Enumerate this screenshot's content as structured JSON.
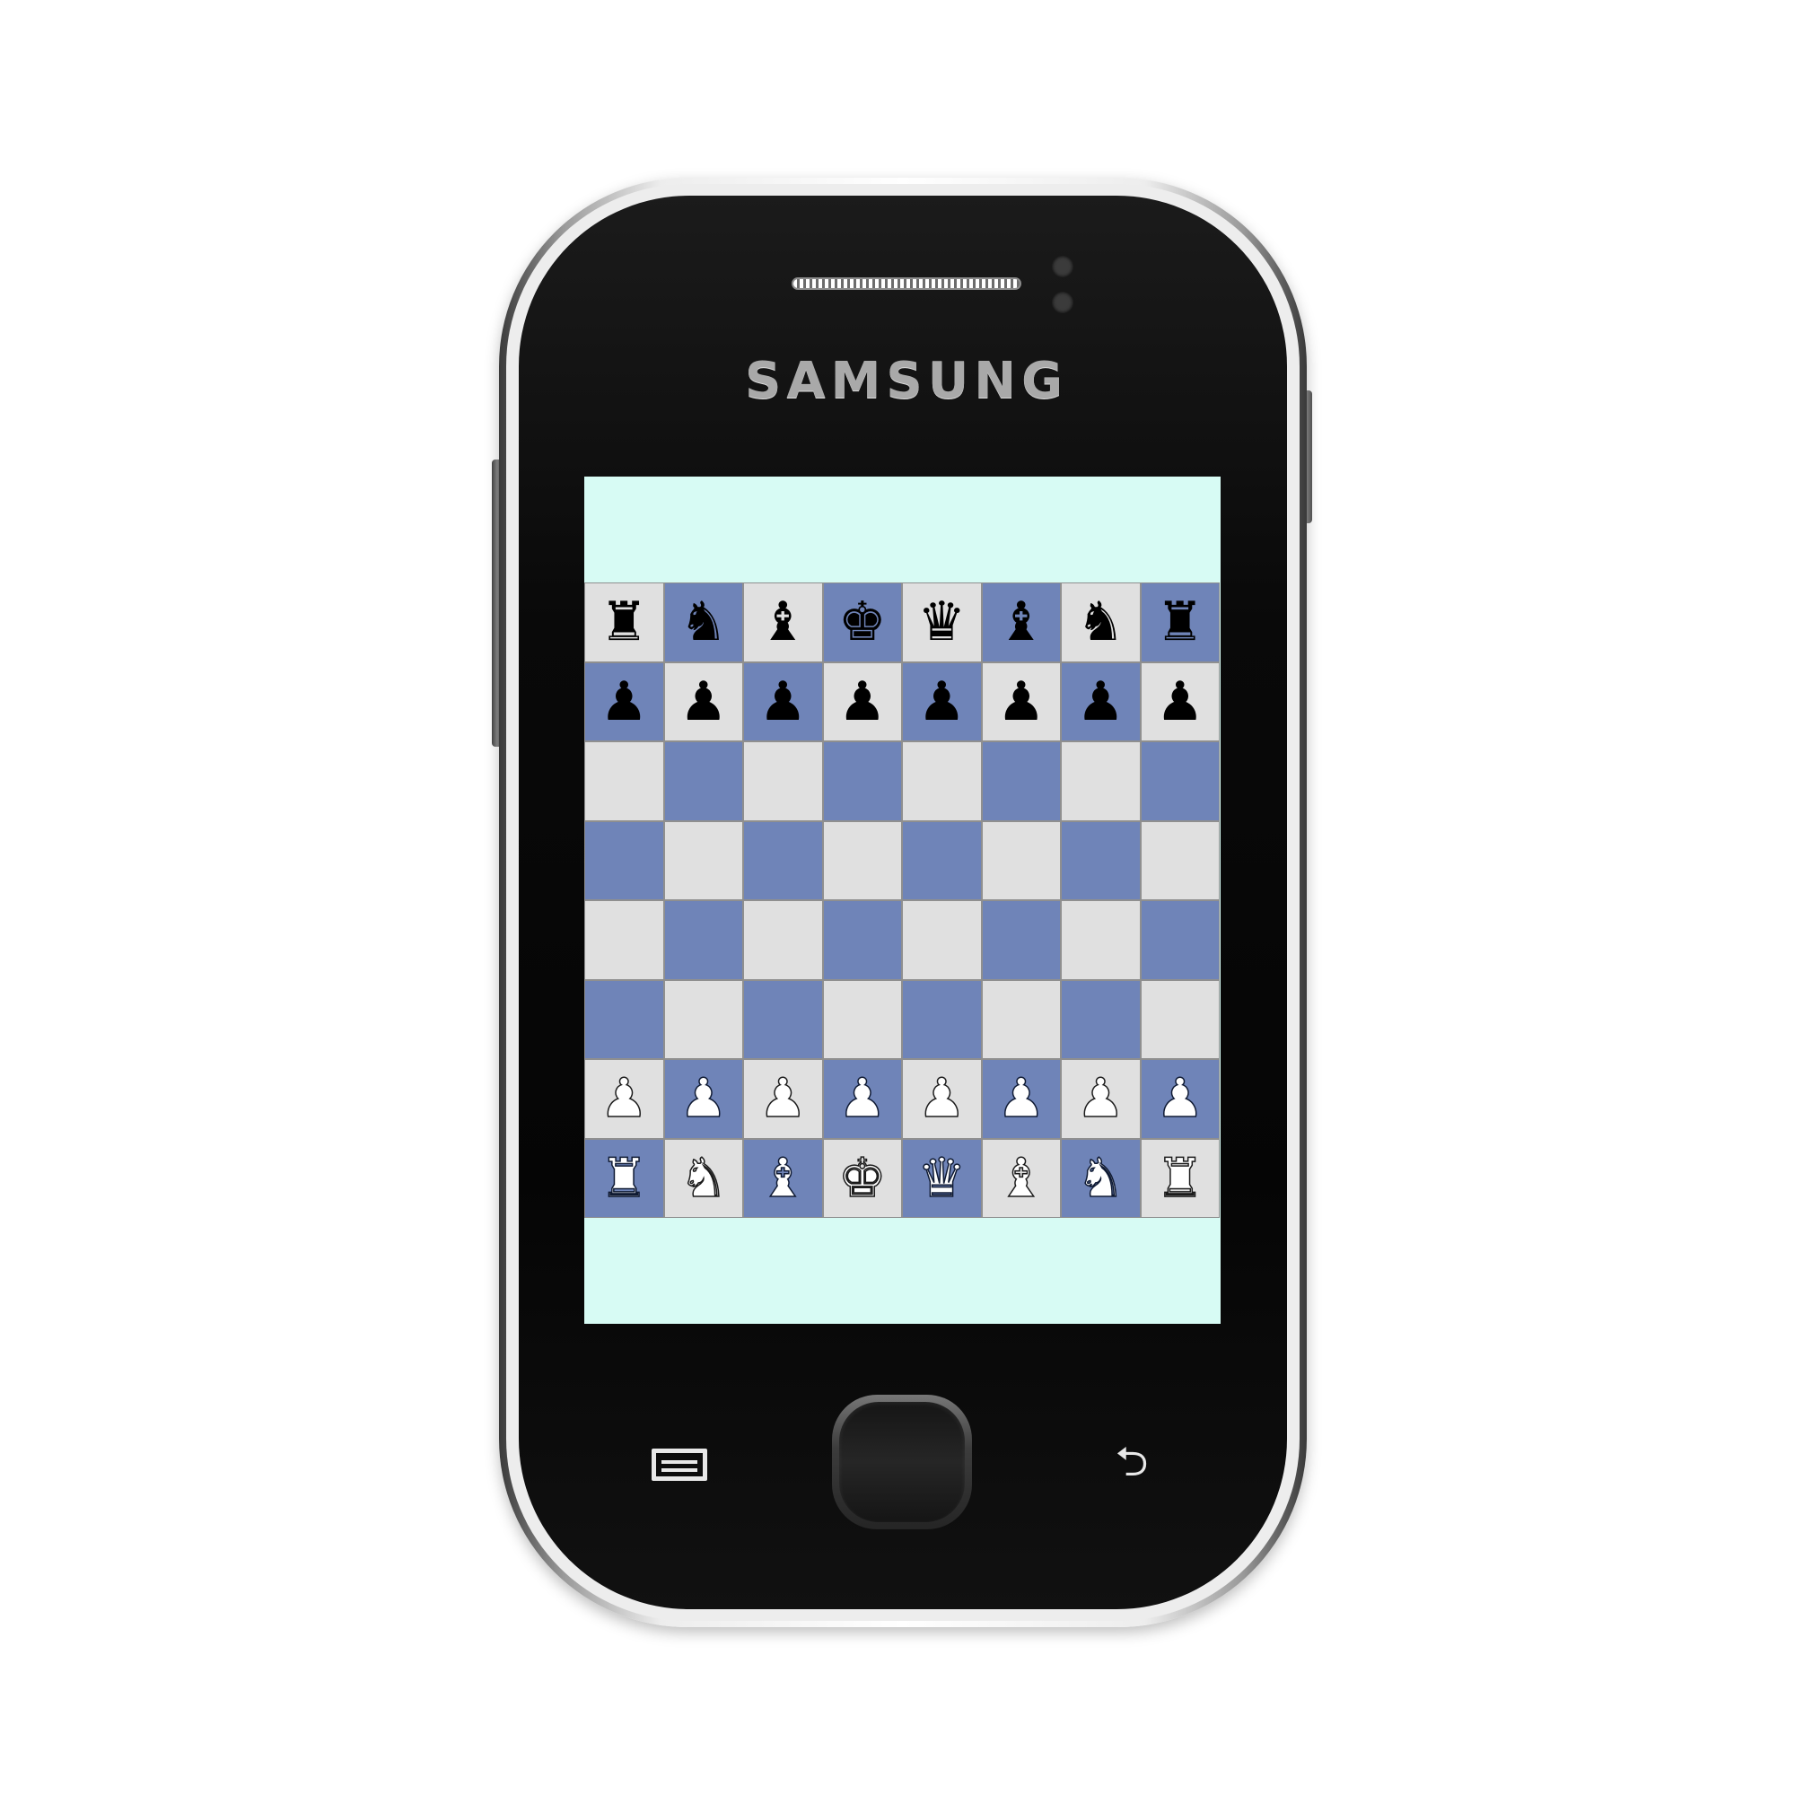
{
  "device": {
    "brand": "SAMSUNG",
    "colors": {
      "body": "#0a0a0a",
      "bezel": "#ededed",
      "brand_text": "#a9a9a9"
    },
    "hardware_buttons": {
      "menu_icon": "menu-icon",
      "home_icon": "home-button",
      "back_icon": "back-arrow-icon"
    }
  },
  "app": {
    "screen_background": "#d7fbf4",
    "colors": {
      "light_square": "#e0e0e0",
      "dark_square": "#6f84b8",
      "black_piece": "#000000",
      "white_piece": "#ffffff"
    },
    "board": {
      "rows": [
        {
          "squares": [
            {
              "piece": "♜",
              "name": "black-rook-icon",
              "color": "black",
              "shade": "light"
            },
            {
              "piece": "♞",
              "name": "black-knight-icon",
              "color": "black",
              "shade": "dark"
            },
            {
              "piece": "♝",
              "name": "black-bishop-icon",
              "color": "black",
              "shade": "light"
            },
            {
              "piece": "♚",
              "name": "black-king-icon",
              "color": "black",
              "shade": "dark"
            },
            {
              "piece": "♛",
              "name": "black-queen-icon",
              "color": "black",
              "shade": "light"
            },
            {
              "piece": "♝",
              "name": "black-bishop-icon",
              "color": "black",
              "shade": "dark"
            },
            {
              "piece": "♞",
              "name": "black-knight-icon",
              "color": "black",
              "shade": "light"
            },
            {
              "piece": "♜",
              "name": "black-rook-icon",
              "color": "black",
              "shade": "dark"
            }
          ]
        },
        {
          "squares": [
            {
              "piece": "♟",
              "name": "black-pawn-icon",
              "color": "black",
              "shade": "dark"
            },
            {
              "piece": "♟",
              "name": "black-pawn-icon",
              "color": "black",
              "shade": "light"
            },
            {
              "piece": "♟",
              "name": "black-pawn-icon",
              "color": "black",
              "shade": "dark"
            },
            {
              "piece": "♟",
              "name": "black-pawn-icon",
              "color": "black",
              "shade": "light"
            },
            {
              "piece": "♟",
              "name": "black-pawn-icon",
              "color": "black",
              "shade": "dark"
            },
            {
              "piece": "♟",
              "name": "black-pawn-icon",
              "color": "black",
              "shade": "light"
            },
            {
              "piece": "♟",
              "name": "black-pawn-icon",
              "color": "black",
              "shade": "dark"
            },
            {
              "piece": "♟",
              "name": "black-pawn-icon",
              "color": "black",
              "shade": "light"
            }
          ]
        },
        {
          "squares": [
            {
              "piece": "",
              "shade": "light"
            },
            {
              "piece": "",
              "shade": "dark"
            },
            {
              "piece": "",
              "shade": "light"
            },
            {
              "piece": "",
              "shade": "dark"
            },
            {
              "piece": "",
              "shade": "light"
            },
            {
              "piece": "",
              "shade": "dark"
            },
            {
              "piece": "",
              "shade": "light"
            },
            {
              "piece": "",
              "shade": "dark"
            }
          ]
        },
        {
          "squares": [
            {
              "piece": "",
              "shade": "dark"
            },
            {
              "piece": "",
              "shade": "light"
            },
            {
              "piece": "",
              "shade": "dark"
            },
            {
              "piece": "",
              "shade": "light"
            },
            {
              "piece": "",
              "shade": "dark"
            },
            {
              "piece": "",
              "shade": "light"
            },
            {
              "piece": "",
              "shade": "dark"
            },
            {
              "piece": "",
              "shade": "light"
            }
          ]
        },
        {
          "squares": [
            {
              "piece": "",
              "shade": "light"
            },
            {
              "piece": "",
              "shade": "dark"
            },
            {
              "piece": "",
              "shade": "light"
            },
            {
              "piece": "",
              "shade": "dark"
            },
            {
              "piece": "",
              "shade": "light"
            },
            {
              "piece": "",
              "shade": "dark"
            },
            {
              "piece": "",
              "shade": "light"
            },
            {
              "piece": "",
              "shade": "dark"
            }
          ]
        },
        {
          "squares": [
            {
              "piece": "",
              "shade": "dark"
            },
            {
              "piece": "",
              "shade": "light"
            },
            {
              "piece": "",
              "shade": "dark"
            },
            {
              "piece": "",
              "shade": "light"
            },
            {
              "piece": "",
              "shade": "dark"
            },
            {
              "piece": "",
              "shade": "light"
            },
            {
              "piece": "",
              "shade": "dark"
            },
            {
              "piece": "",
              "shade": "light"
            }
          ]
        },
        {
          "squares": [
            {
              "piece": "♟",
              "name": "white-pawn-icon",
              "color": "white",
              "shade": "light"
            },
            {
              "piece": "♟",
              "name": "white-pawn-icon",
              "color": "white",
              "shade": "dark"
            },
            {
              "piece": "♟",
              "name": "white-pawn-icon",
              "color": "white",
              "shade": "light"
            },
            {
              "piece": "♟",
              "name": "white-pawn-icon",
              "color": "white",
              "shade": "dark"
            },
            {
              "piece": "♟",
              "name": "white-pawn-icon",
              "color": "white",
              "shade": "light"
            },
            {
              "piece": "♟",
              "name": "white-pawn-icon",
              "color": "white",
              "shade": "dark"
            },
            {
              "piece": "♟",
              "name": "white-pawn-icon",
              "color": "white",
              "shade": "light"
            },
            {
              "piece": "♟",
              "name": "white-pawn-icon",
              "color": "white",
              "shade": "dark"
            }
          ]
        },
        {
          "squares": [
            {
              "piece": "♜",
              "name": "white-rook-icon",
              "color": "white",
              "shade": "dark"
            },
            {
              "piece": "♞",
              "name": "white-knight-icon",
              "color": "white",
              "shade": "light"
            },
            {
              "piece": "♝",
              "name": "white-bishop-icon",
              "color": "white",
              "shade": "dark"
            },
            {
              "piece": "♚",
              "name": "white-king-icon",
              "color": "white",
              "shade": "light"
            },
            {
              "piece": "♛",
              "name": "white-queen-icon",
              "color": "white",
              "shade": "dark"
            },
            {
              "piece": "♝",
              "name": "white-bishop-icon",
              "color": "white",
              "shade": "light"
            },
            {
              "piece": "♞",
              "name": "white-knight-icon",
              "color": "white",
              "shade": "dark"
            },
            {
              "piece": "♜",
              "name": "white-rook-icon",
              "color": "white",
              "shade": "light"
            }
          ]
        }
      ]
    }
  }
}
